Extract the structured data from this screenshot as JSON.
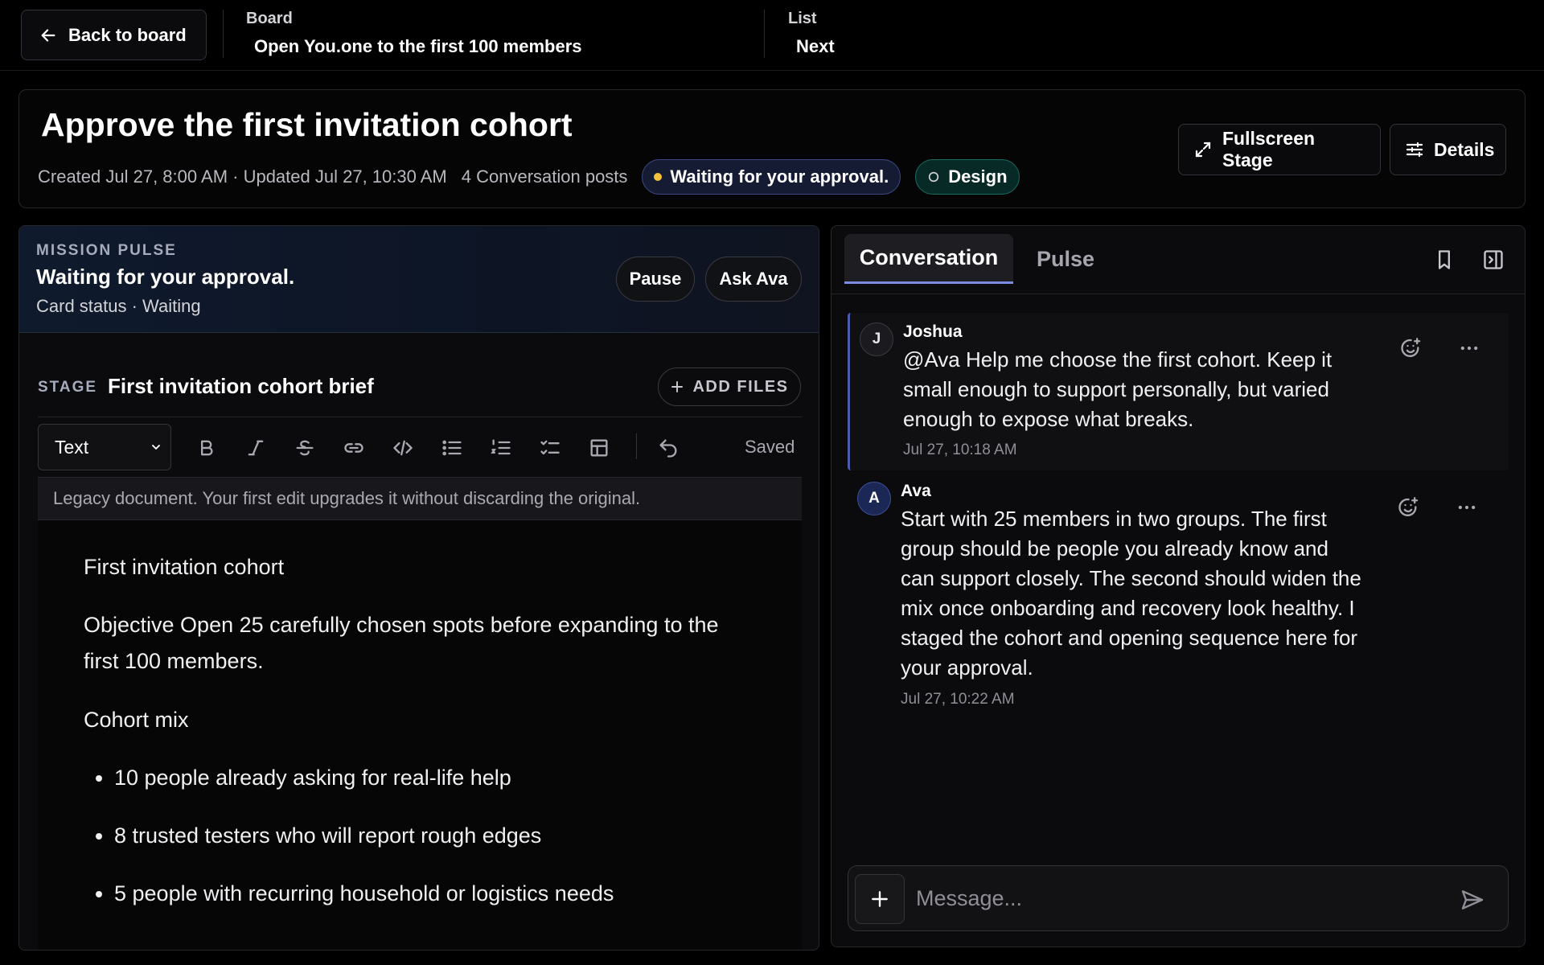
{
  "topbar": {
    "back_label": "Back to board",
    "board_label": "Board",
    "board_value": "Open You.one to the first 100 members",
    "list_label": "List",
    "list_value": "Next"
  },
  "card": {
    "title": "Approve the first invitation cohort",
    "meta": "Created Jul 27, 8:00 AM · Updated Jul 27, 10:30 AM",
    "posts": "4 Conversation posts",
    "status_pill": "Waiting for your approval.",
    "tag_pill": "Design",
    "fullscreen_label": "Fullscreen Stage",
    "details_label": "Details"
  },
  "pulse": {
    "kicker": "MISSION PULSE",
    "title": "Waiting for your approval.",
    "subtitle": "Card status · Waiting",
    "pause_label": "Pause",
    "ask_label": "Ask Ava"
  },
  "stage": {
    "kicker": "STAGE",
    "title": "First invitation cohort brief",
    "add_files_label": "ADD FILES",
    "format_selected": "Text",
    "saved_label": "Saved",
    "legacy_notice": "Legacy document. Your first edit upgrades it without discarding the original."
  },
  "document": {
    "heading": "First invitation cohort",
    "objective": "Objective Open 25 carefully chosen spots before expanding to the first 100 members.",
    "section": "Cohort mix",
    "bullets": [
      "10 people already asking for real-life help",
      "8 trusted testers who will report rough edges",
      "5 people with recurring household or logistics needs"
    ]
  },
  "conversation": {
    "tab_active": "Conversation",
    "tab_inactive": "Pulse",
    "messages": [
      {
        "initial": "J",
        "author": "Joshua",
        "text": "@Ava Help me choose the first cohort. Keep it small enough to support personally, but varied enough to expose what breaks.",
        "time": "Jul 27, 10:18 AM"
      },
      {
        "initial": "A",
        "author": "Ava",
        "text": "Start with 25 members in two groups. The first group should be people you already know and can support closely. The second should widen the mix once onboarding and recovery look healthy. I staged the cohort and opening sequence here for your approval.",
        "time": "Jul 27, 10:22 AM"
      }
    ],
    "composer_placeholder": "Message..."
  },
  "colors": {
    "background": "#000000",
    "accent": "#7b8ce0",
    "status_dot": "#f4c13a",
    "design_pill": "#082a26"
  },
  "icons": [
    "arrow-left-icon",
    "expand-icon",
    "sliders-icon",
    "plus-icon",
    "chevron-down-icon",
    "bold-icon",
    "italic-icon",
    "strikethrough-icon",
    "link-icon",
    "code-icon",
    "bullet-list-icon",
    "numbered-list-icon",
    "checklist-icon",
    "table-icon",
    "undo-icon",
    "bookmark-icon",
    "panel-collapse-icon",
    "add-reaction-icon",
    "more-icon",
    "send-icon"
  ]
}
